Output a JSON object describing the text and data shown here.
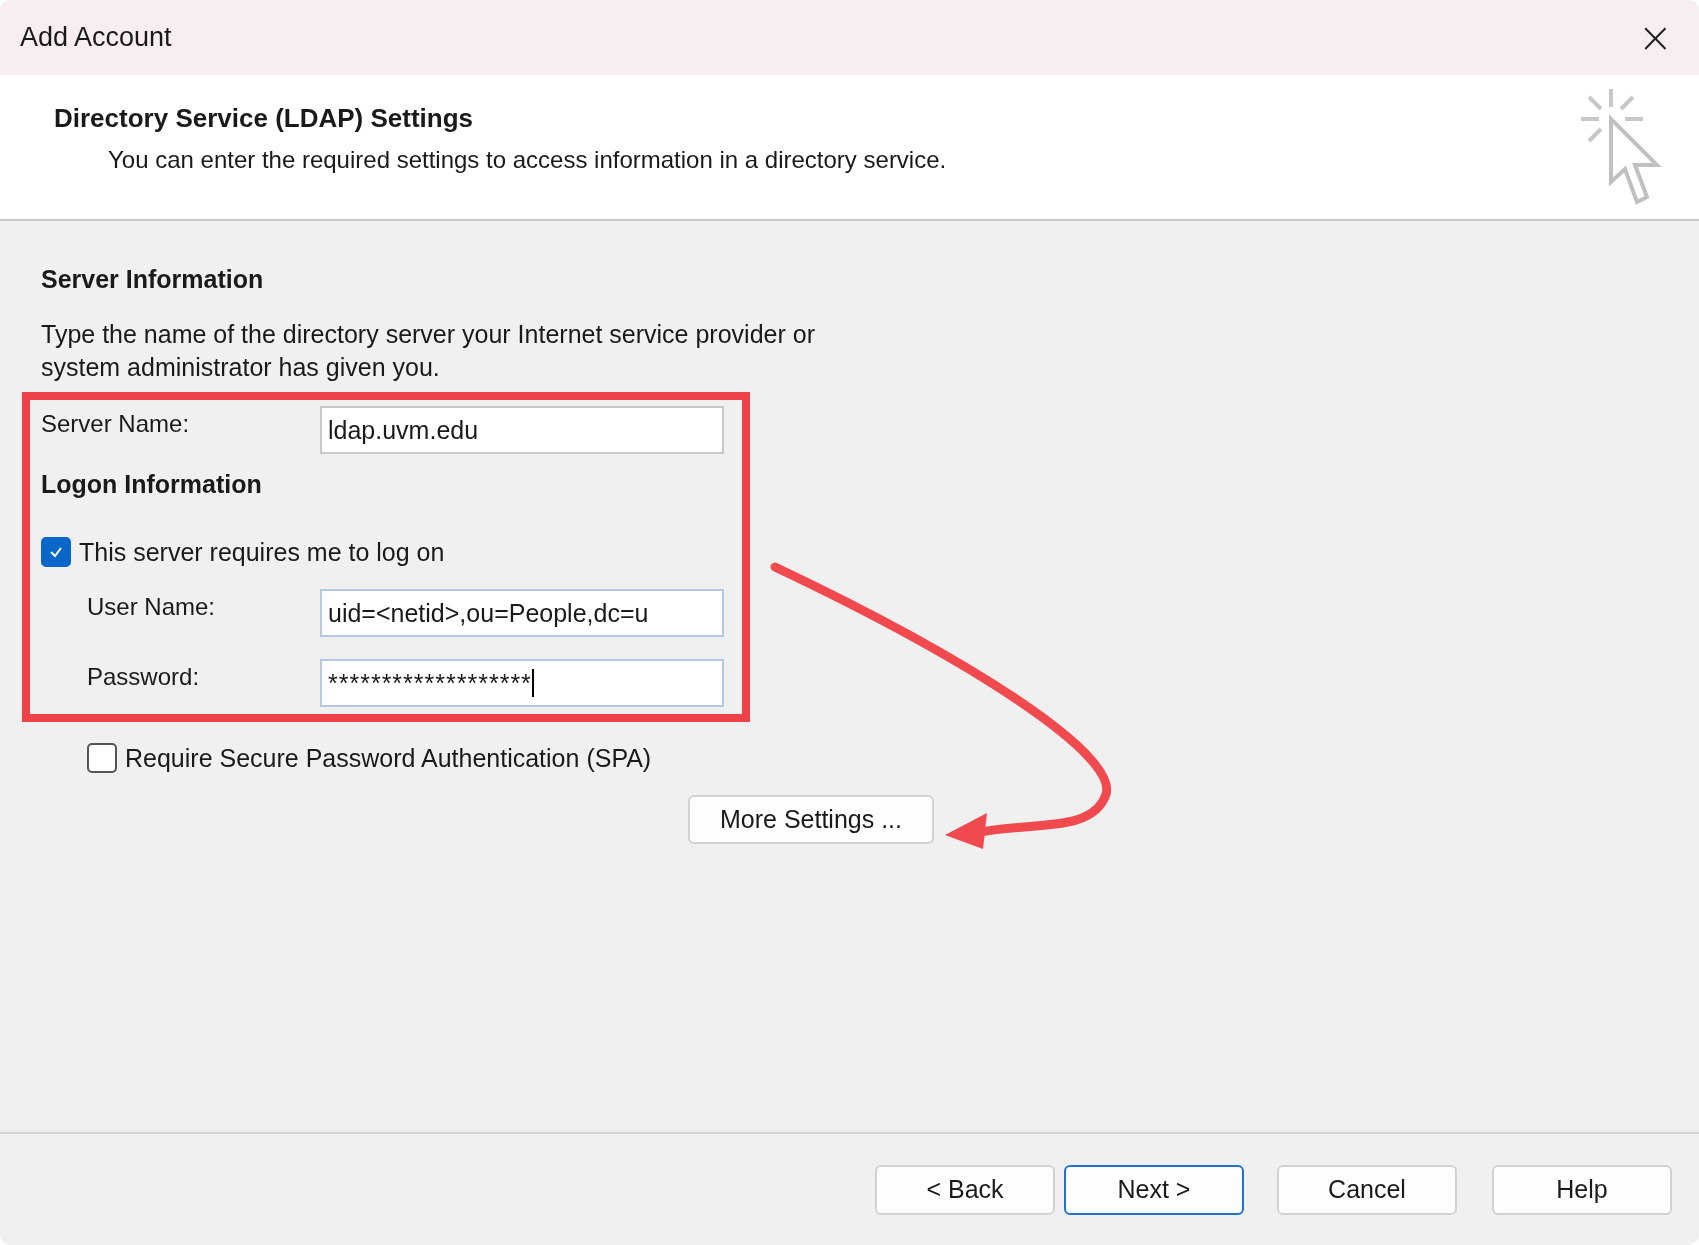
{
  "window": {
    "title": "Add Account",
    "close": "×"
  },
  "header": {
    "title": "Directory Service (LDAP) Settings",
    "subtitle": "You can enter the required settings to access information in a directory service."
  },
  "server_information": {
    "heading": "Server Information",
    "description": "Type the name of the directory server your Internet service provider or system administrator has given you.",
    "server_name": {
      "label": "Server Name:",
      "value": "ldap.uvm.edu"
    }
  },
  "logon_information": {
    "heading": "Logon Information",
    "requires_logon": {
      "label": "This server requires me to log on",
      "checked": true
    },
    "user_name": {
      "label": "User Name:",
      "value": "uid=<netid>,ou=People,dc=u"
    },
    "password": {
      "label": "Password:",
      "value": "*******************"
    }
  },
  "require_spa": {
    "label": "Require Secure Password Authentication (SPA)",
    "checked": false
  },
  "more_settings": "More Settings ...",
  "buttons": [
    {
      "label": "< Back",
      "selected": false
    },
    {
      "label": "Next >",
      "selected": true
    },
    {
      "label": "Cancel",
      "selected": false
    },
    {
      "label": "Help",
      "selected": false
    }
  ]
}
